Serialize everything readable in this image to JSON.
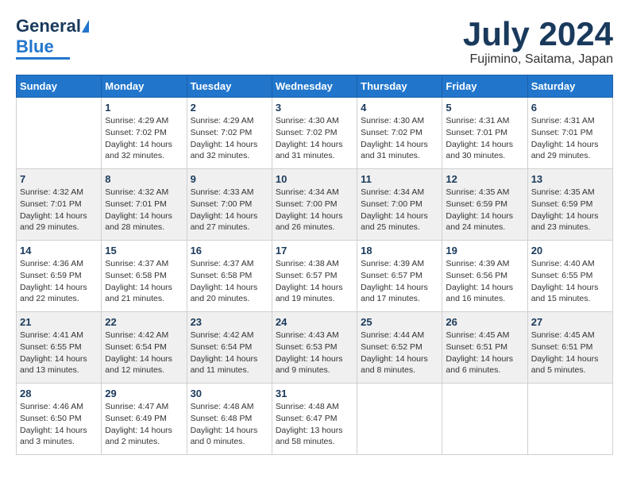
{
  "header": {
    "logo_general": "General",
    "logo_blue": "Blue",
    "month_title": "July 2024",
    "subtitle": "Fujimino, Saitama, Japan"
  },
  "days_of_week": [
    "Sunday",
    "Monday",
    "Tuesday",
    "Wednesday",
    "Thursday",
    "Friday",
    "Saturday"
  ],
  "weeks": [
    [
      {
        "day": "",
        "info": ""
      },
      {
        "day": "1",
        "info": "Sunrise: 4:29 AM\nSunset: 7:02 PM\nDaylight: 14 hours\nand 32 minutes."
      },
      {
        "day": "2",
        "info": "Sunrise: 4:29 AM\nSunset: 7:02 PM\nDaylight: 14 hours\nand 32 minutes."
      },
      {
        "day": "3",
        "info": "Sunrise: 4:30 AM\nSunset: 7:02 PM\nDaylight: 14 hours\nand 31 minutes."
      },
      {
        "day": "4",
        "info": "Sunrise: 4:30 AM\nSunset: 7:02 PM\nDaylight: 14 hours\nand 31 minutes."
      },
      {
        "day": "5",
        "info": "Sunrise: 4:31 AM\nSunset: 7:01 PM\nDaylight: 14 hours\nand 30 minutes."
      },
      {
        "day": "6",
        "info": "Sunrise: 4:31 AM\nSunset: 7:01 PM\nDaylight: 14 hours\nand 29 minutes."
      }
    ],
    [
      {
        "day": "7",
        "info": "Sunrise: 4:32 AM\nSunset: 7:01 PM\nDaylight: 14 hours\nand 29 minutes."
      },
      {
        "day": "8",
        "info": "Sunrise: 4:32 AM\nSunset: 7:01 PM\nDaylight: 14 hours\nand 28 minutes."
      },
      {
        "day": "9",
        "info": "Sunrise: 4:33 AM\nSunset: 7:00 PM\nDaylight: 14 hours\nand 27 minutes."
      },
      {
        "day": "10",
        "info": "Sunrise: 4:34 AM\nSunset: 7:00 PM\nDaylight: 14 hours\nand 26 minutes."
      },
      {
        "day": "11",
        "info": "Sunrise: 4:34 AM\nSunset: 7:00 PM\nDaylight: 14 hours\nand 25 minutes."
      },
      {
        "day": "12",
        "info": "Sunrise: 4:35 AM\nSunset: 6:59 PM\nDaylight: 14 hours\nand 24 minutes."
      },
      {
        "day": "13",
        "info": "Sunrise: 4:35 AM\nSunset: 6:59 PM\nDaylight: 14 hours\nand 23 minutes."
      }
    ],
    [
      {
        "day": "14",
        "info": "Sunrise: 4:36 AM\nSunset: 6:59 PM\nDaylight: 14 hours\nand 22 minutes."
      },
      {
        "day": "15",
        "info": "Sunrise: 4:37 AM\nSunset: 6:58 PM\nDaylight: 14 hours\nand 21 minutes."
      },
      {
        "day": "16",
        "info": "Sunrise: 4:37 AM\nSunset: 6:58 PM\nDaylight: 14 hours\nand 20 minutes."
      },
      {
        "day": "17",
        "info": "Sunrise: 4:38 AM\nSunset: 6:57 PM\nDaylight: 14 hours\nand 19 minutes."
      },
      {
        "day": "18",
        "info": "Sunrise: 4:39 AM\nSunset: 6:57 PM\nDaylight: 14 hours\nand 17 minutes."
      },
      {
        "day": "19",
        "info": "Sunrise: 4:39 AM\nSunset: 6:56 PM\nDaylight: 14 hours\nand 16 minutes."
      },
      {
        "day": "20",
        "info": "Sunrise: 4:40 AM\nSunset: 6:55 PM\nDaylight: 14 hours\nand 15 minutes."
      }
    ],
    [
      {
        "day": "21",
        "info": "Sunrise: 4:41 AM\nSunset: 6:55 PM\nDaylight: 14 hours\nand 13 minutes."
      },
      {
        "day": "22",
        "info": "Sunrise: 4:42 AM\nSunset: 6:54 PM\nDaylight: 14 hours\nand 12 minutes."
      },
      {
        "day": "23",
        "info": "Sunrise: 4:42 AM\nSunset: 6:54 PM\nDaylight: 14 hours\nand 11 minutes."
      },
      {
        "day": "24",
        "info": "Sunrise: 4:43 AM\nSunset: 6:53 PM\nDaylight: 14 hours\nand 9 minutes."
      },
      {
        "day": "25",
        "info": "Sunrise: 4:44 AM\nSunset: 6:52 PM\nDaylight: 14 hours\nand 8 minutes."
      },
      {
        "day": "26",
        "info": "Sunrise: 4:45 AM\nSunset: 6:51 PM\nDaylight: 14 hours\nand 6 minutes."
      },
      {
        "day": "27",
        "info": "Sunrise: 4:45 AM\nSunset: 6:51 PM\nDaylight: 14 hours\nand 5 minutes."
      }
    ],
    [
      {
        "day": "28",
        "info": "Sunrise: 4:46 AM\nSunset: 6:50 PM\nDaylight: 14 hours\nand 3 minutes."
      },
      {
        "day": "29",
        "info": "Sunrise: 4:47 AM\nSunset: 6:49 PM\nDaylight: 14 hours\nand 2 minutes."
      },
      {
        "day": "30",
        "info": "Sunrise: 4:48 AM\nSunset: 6:48 PM\nDaylight: 14 hours\nand 0 minutes."
      },
      {
        "day": "31",
        "info": "Sunrise: 4:48 AM\nSunset: 6:47 PM\nDaylight: 13 hours\nand 58 minutes."
      },
      {
        "day": "",
        "info": ""
      },
      {
        "day": "",
        "info": ""
      },
      {
        "day": "",
        "info": ""
      }
    ]
  ]
}
